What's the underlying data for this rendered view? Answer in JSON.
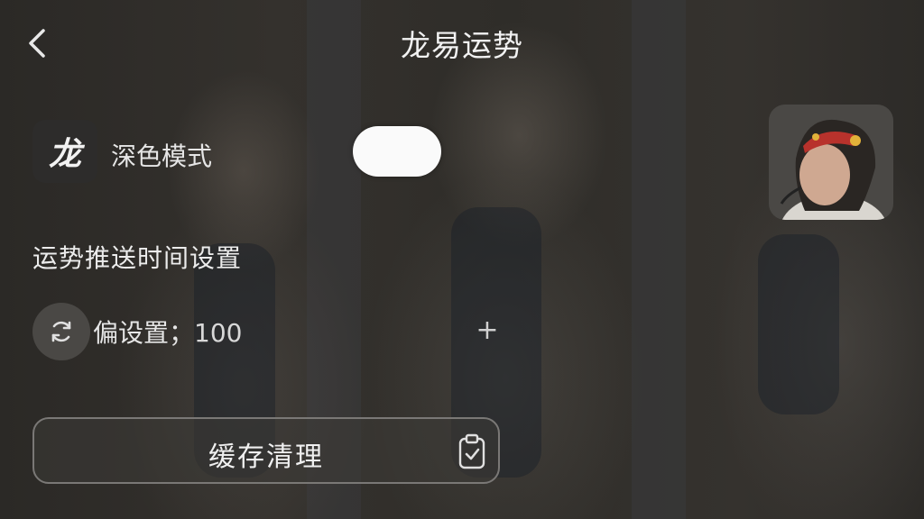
{
  "header": {
    "title": "龙易运势",
    "back_icon": "chevron-left-icon"
  },
  "dark_mode": {
    "logo_text": "龙",
    "label": "深色模式",
    "enabled": false
  },
  "push_settings": {
    "title": "运势推送时间设置",
    "offset_label": "偏设置；",
    "offset_value": "100",
    "offset_icon": "refresh-icon",
    "increment_symbol": "+"
  },
  "cache": {
    "button_label": "缓存清理",
    "icon": "clipboard-check-icon"
  },
  "colors": {
    "toggle": "#fafafa",
    "text": "#e8e8e8",
    "button_border": "#7a7876"
  }
}
